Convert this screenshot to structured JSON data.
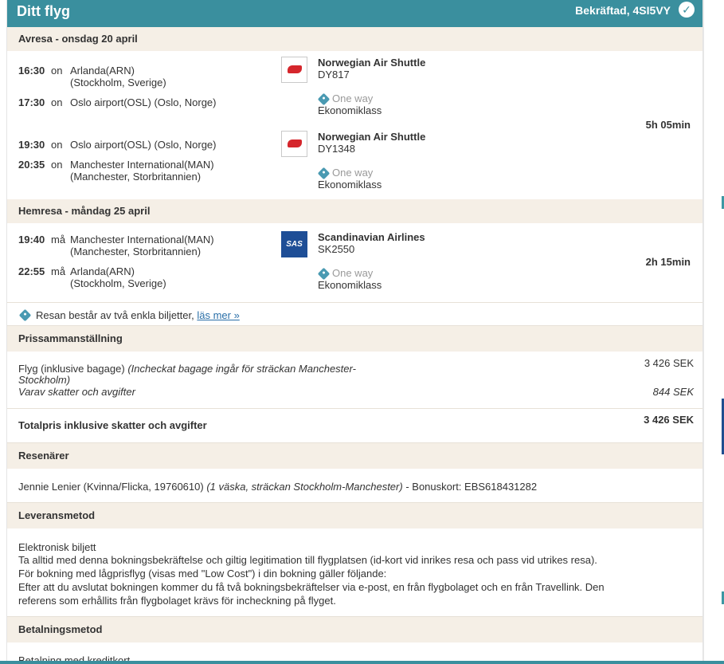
{
  "header": {
    "title": "Ditt flyg",
    "status": "Bekräftad, 4SI5VY"
  },
  "outbound": {
    "heading": "Avresa - onsdag 20 april",
    "duration": "5h 05min",
    "legs": [
      {
        "dep_time": "16:30",
        "dep_word": "on",
        "dep_place": "Arlanda(ARN)",
        "dep_place2": "(Stockholm, Sverige)",
        "arr_time": "17:30",
        "arr_word": "on",
        "arr_place": "Oslo airport(OSL) (Oslo, Norge)",
        "airline": "Norwegian Air Shuttle",
        "flight": "DY817",
        "type": "One way",
        "cabin": "Ekonomiklass",
        "logo": "norwegian-logo"
      },
      {
        "dep_time": "19:30",
        "dep_word": "on",
        "dep_place": "Oslo airport(OSL) (Oslo, Norge)",
        "arr_time": "20:35",
        "arr_word": "on",
        "arr_place": "Manchester International(MAN)",
        "arr_place2": "(Manchester, Storbritannien)",
        "airline": "Norwegian Air Shuttle",
        "flight": "DY1348",
        "type": "One way",
        "cabin": "Ekonomiklass",
        "logo": "norwegian-logo"
      }
    ]
  },
  "return": {
    "heading": "Hemresa - måndag 25 april",
    "duration": "2h 15min",
    "leg": {
      "dep_time": "19:40",
      "dep_word": "må",
      "dep_place": "Manchester International(MAN)",
      "dep_place2": "(Manchester, Storbritannien)",
      "arr_time": "22:55",
      "arr_word": "må",
      "arr_place": "Arlanda(ARN)",
      "arr_place2": "(Stockholm, Sverige)",
      "airline": "Scandinavian Airlines",
      "flight": "SK2550",
      "type": "One way",
      "cabin": "Ekonomiklass",
      "logo_text": "SAS"
    }
  },
  "ticket_note": {
    "text": "Resan består av två enkla biljetter,",
    "link": "läs mer »"
  },
  "price": {
    "heading": "Prissammanställning",
    "flight_label": "Flyg (inklusive bagage)",
    "flight_note_1": "(Incheckat bagage ingår för sträckan Manchester-",
    "flight_note_2": "Stockholm)",
    "flight_amount": "3 426 SEK",
    "tax_label": "Varav skatter och avgifter",
    "tax_amount": "844 SEK",
    "total_label": "Totalpris inklusive skatter och avgifter",
    "total_amount": "3 426 SEK"
  },
  "travelers": {
    "heading": "Resenärer",
    "name": "Jennie Lenier (Kvinna/Flicka, 19760610)",
    "bags": "(1 väska, sträckan Stockholm-Manchester)",
    "bonus": "- Bonuskort: EBS618431282"
  },
  "delivery": {
    "heading": "Leveransmetod",
    "lines": [
      "Elektronisk biljett",
      "Ta alltid med denna bokningsbekräftelse och giltig legitimation till flygplatsen (id-kort vid inrikes resa och pass vid utrikes resa).",
      "För bokning med lågprisflyg (visas med \"Low Cost\") i din bokning gäller följande:",
      "Efter att du avslutat bokningen kommer du få två bokningsbekräftelser via e-post, en från flygbolaget och en från Travellink. Den",
      "referens som erhållits från flygbolaget krävs för incheckning på flyget."
    ]
  },
  "payment": {
    "heading": "Betalningsmetod",
    "method": "Betalning med kreditkort"
  },
  "icons": {
    "confirmed": "check-circle-icon",
    "fare": "tag-icon"
  },
  "colors": {
    "header": "#3a8f9e",
    "section": "#f5efe6",
    "link": "#2a6fa8"
  }
}
